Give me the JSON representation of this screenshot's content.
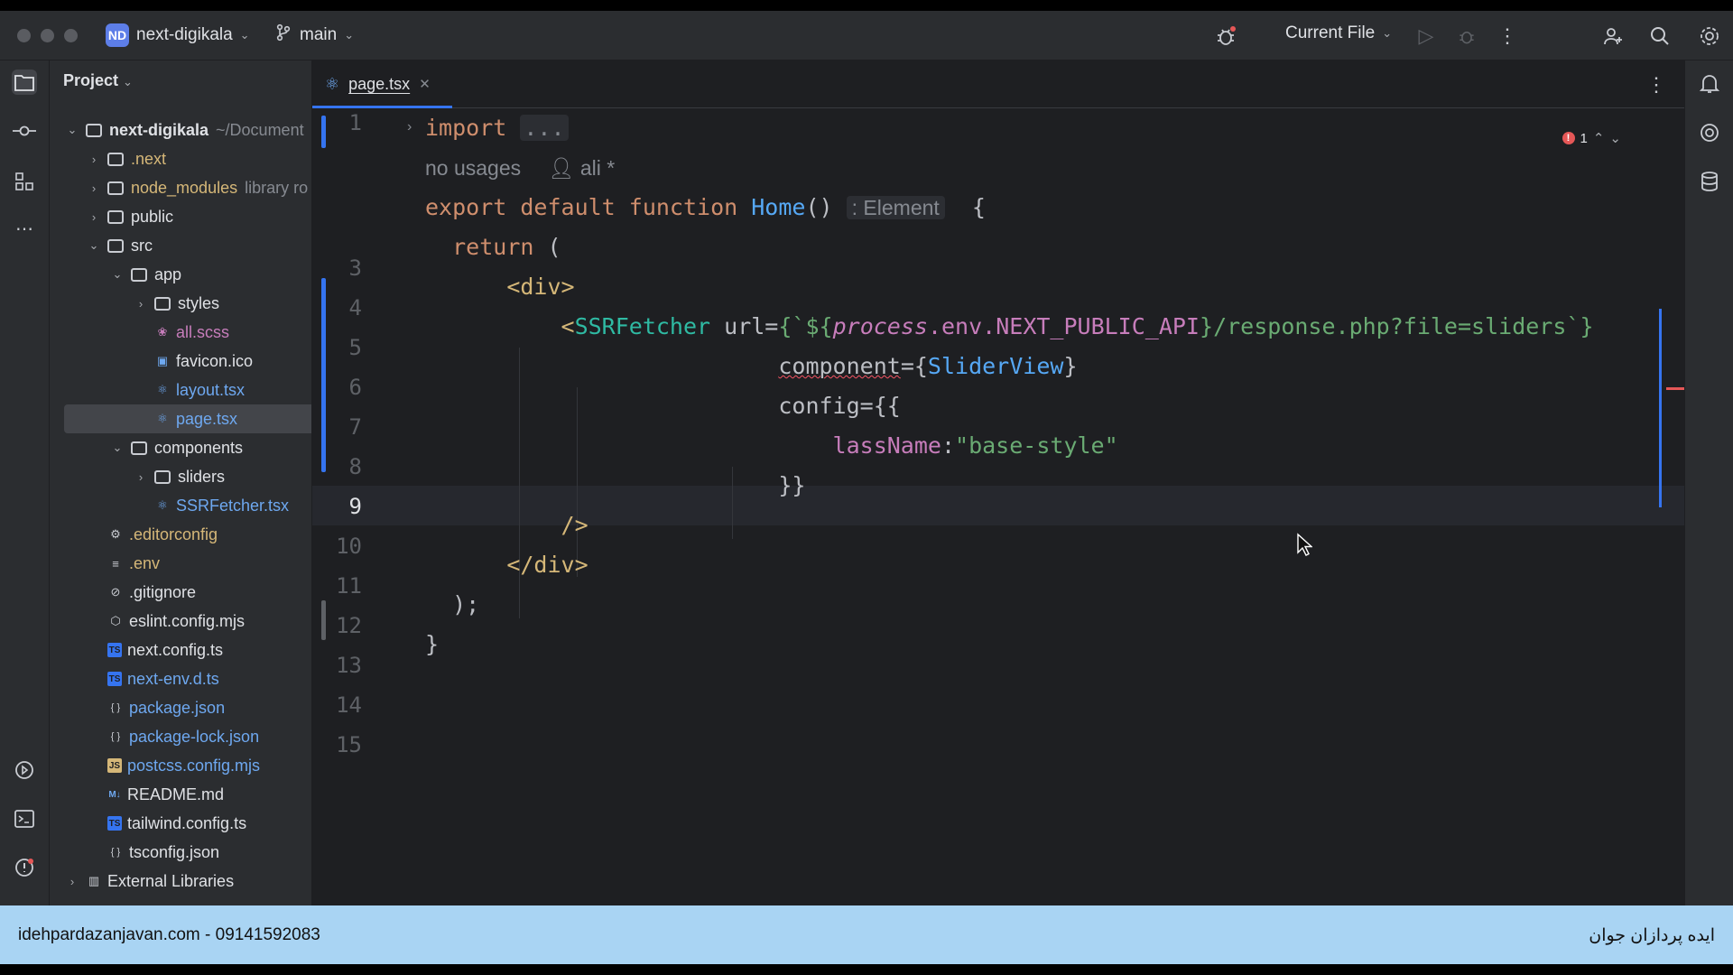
{
  "titlebar": {
    "project_badge": "ND",
    "project_name": "next-digikala",
    "branch": "main",
    "run_config": "Current File"
  },
  "project_panel": {
    "title": "Project",
    "root": {
      "name": "next-digikala",
      "path": "~/Document"
    },
    "items": [
      {
        "label": ".next",
        "type": "folder"
      },
      {
        "label": "node_modules",
        "extra": "library ro",
        "type": "folder"
      },
      {
        "label": "public",
        "type": "folder"
      },
      {
        "label": "src",
        "type": "folder"
      },
      {
        "label": "app",
        "type": "folder"
      },
      {
        "label": "styles",
        "type": "folder"
      },
      {
        "label": "all.scss",
        "type": "scss"
      },
      {
        "label": "favicon.ico",
        "type": "image"
      },
      {
        "label": "layout.tsx",
        "type": "tsx"
      },
      {
        "label": "page.tsx",
        "type": "tsx"
      },
      {
        "label": "components",
        "type": "folder"
      },
      {
        "label": "sliders",
        "type": "folder"
      },
      {
        "label": "SSRFetcher.tsx",
        "type": "tsx"
      },
      {
        "label": ".editorconfig",
        "type": "config"
      },
      {
        "label": ".env",
        "type": "text"
      },
      {
        "label": ".gitignore",
        "type": "ignore"
      },
      {
        "label": "eslint.config.mjs",
        "type": "eslint"
      },
      {
        "label": "next.config.ts",
        "type": "ts"
      },
      {
        "label": "next-env.d.ts",
        "type": "ts"
      },
      {
        "label": "package.json",
        "type": "json"
      },
      {
        "label": "package-lock.json",
        "type": "json"
      },
      {
        "label": "postcss.config.mjs",
        "type": "js"
      },
      {
        "label": "README.md",
        "type": "md"
      },
      {
        "label": "tailwind.config.ts",
        "type": "ts"
      },
      {
        "label": "tsconfig.json",
        "type": "json"
      },
      {
        "label": "External Libraries",
        "type": "lib"
      }
    ],
    "icon_labels": {
      "ts": "TS",
      "js": "JS",
      "md": "M↓"
    }
  },
  "editor": {
    "tab_label": "page.tsx",
    "error_count": "1",
    "line_numbers": [
      "1",
      "3",
      "4",
      "5",
      "6",
      "7",
      "8",
      "9",
      "10",
      "11",
      "12",
      "13",
      "14",
      "15"
    ],
    "hints": {
      "usages": "no usages",
      "author": "ali *",
      "return_type": ": Element",
      "fold": "..."
    },
    "code": {
      "l1_kw": "import",
      "l3_a": "export default function",
      "l3_fn": "Home",
      "l3_paren": "()",
      "l3_brace": "{",
      "l4_kw": "return",
      "l4_paren": "(",
      "l5_tag": "<div>",
      "l6_open": "<",
      "l6_comp": "SSRFetcher",
      "l6_attr": "url=",
      "l6_s1": "{`${",
      "l6_process": "process",
      "l6_env": ".env.",
      "l6_const": "NEXT_PUBLIC_API",
      "l6_s2": "}",
      "l6_s3": "/response.php?file=sliders`}",
      "l7_attr": "component",
      "l7_eq": "={",
      "l7_val": "SliderView",
      "l7_close": "}",
      "l8": "config={{",
      "l9_key": "lassName",
      "l9_colon": ":",
      "l9_val": "\"base-style\"",
      "l10": "}}",
      "l11": "/>",
      "l12": "</div>",
      "l13": ");",
      "l14": "}"
    }
  },
  "footer": {
    "left": "idehpardazanjavan.com - 09141592083",
    "right": "ایده پردازان جوان"
  },
  "colors": {
    "accent": "#3574f0",
    "background": "#1e1f22",
    "panel": "#2b2d30",
    "footer": "#a9d4f3"
  }
}
